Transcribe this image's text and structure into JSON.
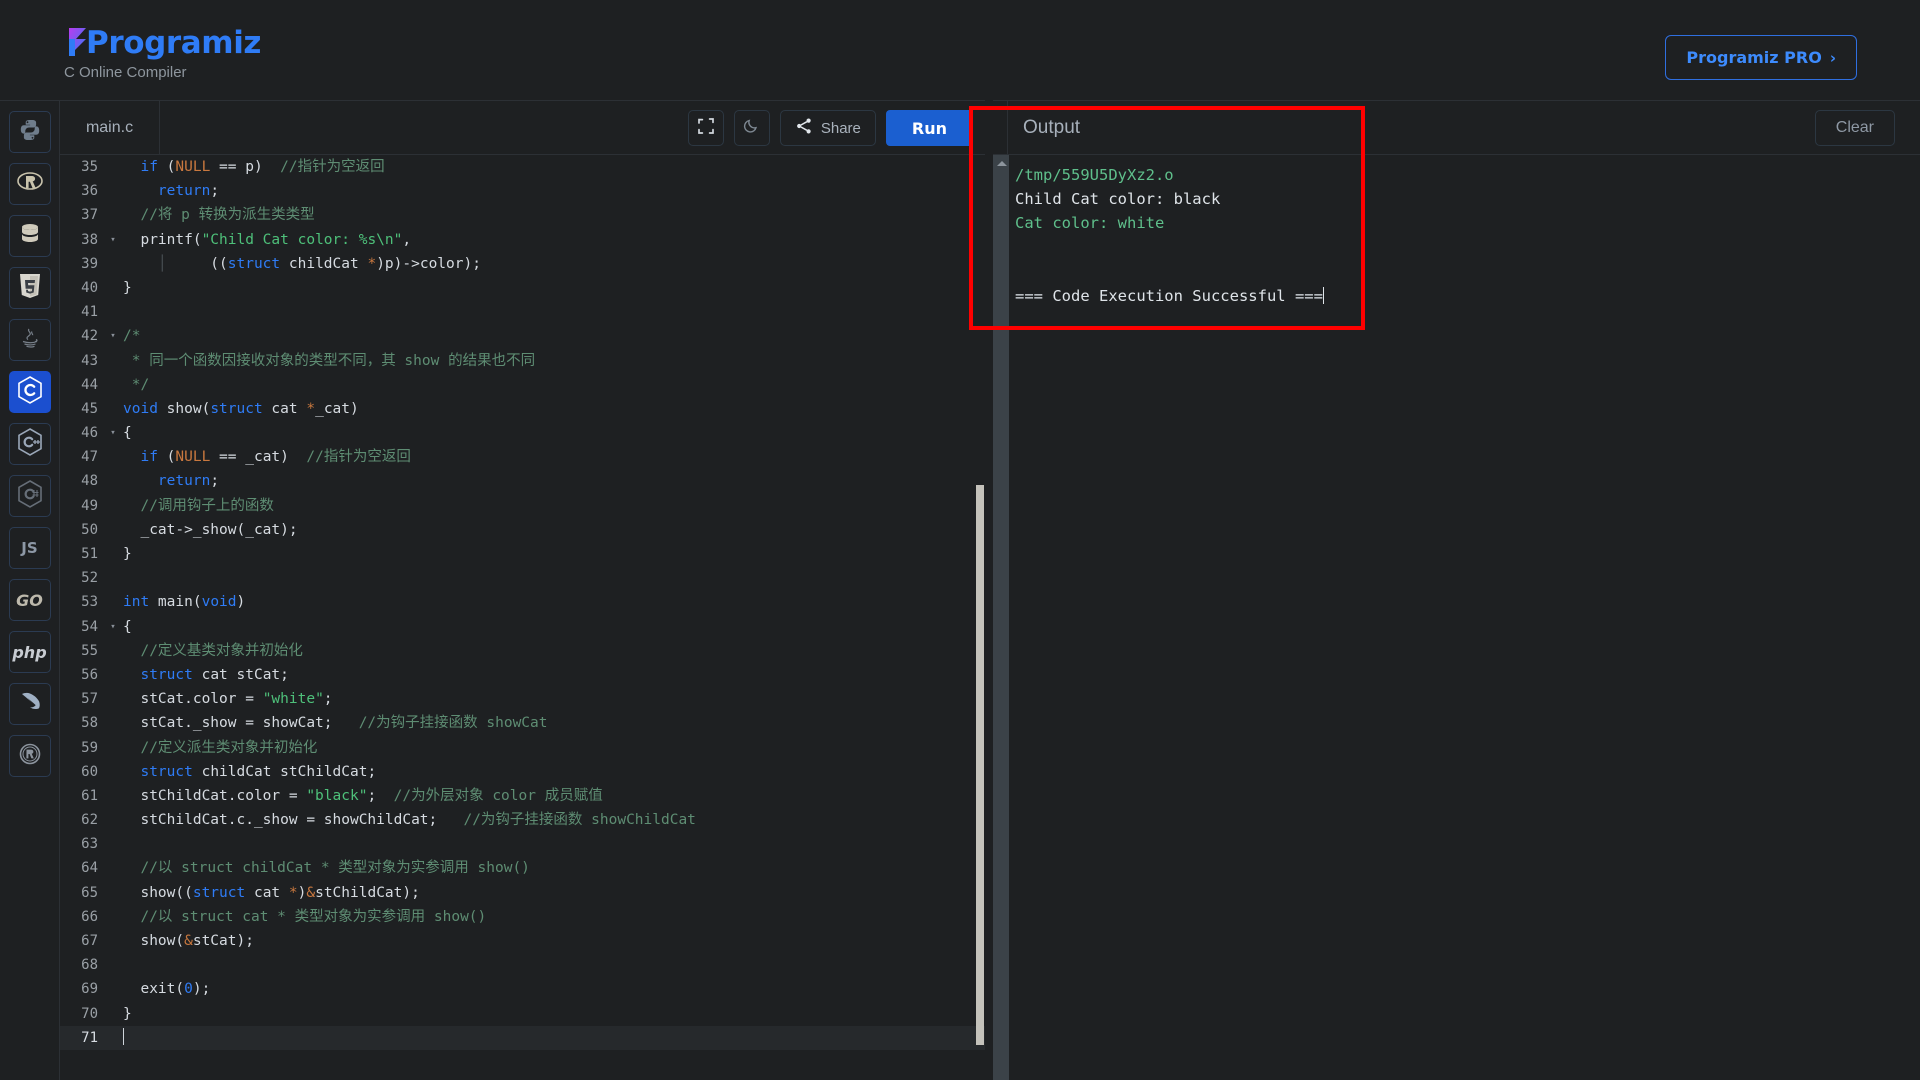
{
  "header": {
    "brand_name": "Programiz",
    "subtitle": "C Online Compiler",
    "pro_button": "Programiz PRO",
    "pro_chevron": "›"
  },
  "sidebar": {
    "items": [
      {
        "name": "python",
        "label": "",
        "icon": "python-icon",
        "active": false
      },
      {
        "name": "r",
        "label": "",
        "icon": "r-icon",
        "active": false
      },
      {
        "name": "sql",
        "label": "",
        "icon": "database-icon",
        "active": false
      },
      {
        "name": "html",
        "label": "",
        "icon": "html5-icon",
        "active": false
      },
      {
        "name": "java",
        "label": "",
        "icon": "java-icon",
        "active": false
      },
      {
        "name": "c",
        "label": "",
        "icon": "c-icon",
        "active": true
      },
      {
        "name": "cpp",
        "label": "",
        "icon": "cpp-icon",
        "active": false
      },
      {
        "name": "csharp",
        "label": "",
        "icon": "csharp-icon",
        "active": false
      },
      {
        "name": "javascript",
        "label": "JS",
        "icon": "js-icon",
        "active": false
      },
      {
        "name": "go",
        "label": "GO",
        "icon": "go-icon",
        "active": false
      },
      {
        "name": "php",
        "label": "php",
        "icon": "php-icon",
        "active": false
      },
      {
        "name": "swift",
        "label": "",
        "icon": "swift-icon",
        "active": false
      },
      {
        "name": "rust",
        "label": "",
        "icon": "rust-icon",
        "active": false
      }
    ]
  },
  "editor": {
    "tab_label": "main.c",
    "fullscreen_icon": "fullscreen-icon",
    "theme_icon": "moon-icon",
    "share_label": "Share",
    "run_label": "Run",
    "active_line": 71,
    "lines": [
      {
        "n": 35,
        "fold": "",
        "tokens": [
          [
            "p",
            "  "
          ],
          [
            "k",
            "if"
          ],
          [
            "p",
            " ("
          ],
          [
            "k2",
            "NULL"
          ],
          [
            "p",
            " == p)  "
          ],
          [
            "c",
            "//指针为空返回"
          ]
        ]
      },
      {
        "n": 36,
        "fold": "",
        "tokens": [
          [
            "p",
            "    "
          ],
          [
            "k",
            "return"
          ],
          [
            "p",
            ";"
          ]
        ]
      },
      {
        "n": 37,
        "fold": "",
        "tokens": [
          [
            "p",
            "  "
          ],
          [
            "c",
            "//将 p 转换为派生类类型"
          ]
        ]
      },
      {
        "n": 38,
        "fold": "▾",
        "tokens": [
          [
            "p",
            "  printf("
          ],
          [
            "s",
            "\"Child Cat color: %s\\n\""
          ],
          [
            "p",
            ","
          ]
        ]
      },
      {
        "n": 39,
        "fold": "",
        "tokens": [
          [
            "p",
            "    "
          ],
          [
            "g",
            "│"
          ],
          [
            "p",
            "     (("
          ],
          [
            "k",
            "struct"
          ],
          [
            "p",
            " childCat "
          ],
          [
            "k2",
            "*"
          ],
          [
            "p",
            ")p)->color);"
          ]
        ]
      },
      {
        "n": 40,
        "fold": "",
        "tokens": [
          [
            "p",
            "}"
          ]
        ]
      },
      {
        "n": 41,
        "fold": "",
        "tokens": []
      },
      {
        "n": 42,
        "fold": "▾",
        "tokens": [
          [
            "c",
            "/*"
          ]
        ]
      },
      {
        "n": 43,
        "fold": "",
        "tokens": [
          [
            "c",
            " * 同一个函数因接收对象的类型不同，其 show 的结果也不同"
          ]
        ]
      },
      {
        "n": 44,
        "fold": "",
        "tokens": [
          [
            "c",
            " */"
          ]
        ]
      },
      {
        "n": 45,
        "fold": "",
        "tokens": [
          [
            "k",
            "void"
          ],
          [
            "p",
            " show("
          ],
          [
            "k",
            "struct"
          ],
          [
            "p",
            " cat "
          ],
          [
            "k2",
            "*"
          ],
          [
            "p",
            "_cat)"
          ]
        ]
      },
      {
        "n": 46,
        "fold": "▾",
        "tokens": [
          [
            "p",
            "{"
          ]
        ]
      },
      {
        "n": 47,
        "fold": "",
        "tokens": [
          [
            "p",
            "  "
          ],
          [
            "k",
            "if"
          ],
          [
            "p",
            " ("
          ],
          [
            "k2",
            "NULL"
          ],
          [
            "p",
            " == _cat)  "
          ],
          [
            "c",
            "//指针为空返回"
          ]
        ]
      },
      {
        "n": 48,
        "fold": "",
        "tokens": [
          [
            "p",
            "    "
          ],
          [
            "k",
            "return"
          ],
          [
            "p",
            ";"
          ]
        ]
      },
      {
        "n": 49,
        "fold": "",
        "tokens": [
          [
            "p",
            "  "
          ],
          [
            "c",
            "//调用钩子上的函数"
          ]
        ]
      },
      {
        "n": 50,
        "fold": "",
        "tokens": [
          [
            "p",
            "  _cat->_show(_cat);"
          ]
        ]
      },
      {
        "n": 51,
        "fold": "",
        "tokens": [
          [
            "p",
            "}"
          ]
        ]
      },
      {
        "n": 52,
        "fold": "",
        "tokens": []
      },
      {
        "n": 53,
        "fold": "",
        "tokens": [
          [
            "k",
            "int"
          ],
          [
            "p",
            " main("
          ],
          [
            "k",
            "void"
          ],
          [
            "p",
            ")"
          ]
        ]
      },
      {
        "n": 54,
        "fold": "▾",
        "tokens": [
          [
            "p",
            "{"
          ]
        ]
      },
      {
        "n": 55,
        "fold": "",
        "tokens": [
          [
            "p",
            "  "
          ],
          [
            "c",
            "//定义基类对象并初始化"
          ]
        ]
      },
      {
        "n": 56,
        "fold": "",
        "tokens": [
          [
            "p",
            "  "
          ],
          [
            "k",
            "struct"
          ],
          [
            "p",
            " cat stCat;"
          ]
        ]
      },
      {
        "n": 57,
        "fold": "",
        "tokens": [
          [
            "p",
            "  stCat.color = "
          ],
          [
            "s",
            "\"white\""
          ],
          [
            "p",
            ";"
          ]
        ]
      },
      {
        "n": 58,
        "fold": "",
        "tokens": [
          [
            "p",
            "  stCat._show = showCat;   "
          ],
          [
            "c",
            "//为钩子挂接函数 showCat"
          ]
        ]
      },
      {
        "n": 59,
        "fold": "",
        "tokens": [
          [
            "p",
            "  "
          ],
          [
            "c",
            "//定义派生类对象并初始化"
          ]
        ]
      },
      {
        "n": 60,
        "fold": "",
        "tokens": [
          [
            "p",
            "  "
          ],
          [
            "k",
            "struct"
          ],
          [
            "p",
            " childCat stChildCat;"
          ]
        ]
      },
      {
        "n": 61,
        "fold": "",
        "tokens": [
          [
            "p",
            "  stChildCat.color = "
          ],
          [
            "s",
            "\"black\""
          ],
          [
            "p",
            "; "
          ],
          [
            "c",
            " //为外层对象 color 成员赋值"
          ]
        ]
      },
      {
        "n": 62,
        "fold": "",
        "tokens": [
          [
            "p",
            "  stChildCat.c._show = showChildCat;   "
          ],
          [
            "c",
            "//为钩子挂接函数 showChildCat"
          ]
        ]
      },
      {
        "n": 63,
        "fold": "",
        "tokens": []
      },
      {
        "n": 64,
        "fold": "",
        "tokens": [
          [
            "p",
            "  "
          ],
          [
            "c",
            "//以 struct childCat * 类型对象为实参调用 show()"
          ]
        ]
      },
      {
        "n": 65,
        "fold": "",
        "tokens": [
          [
            "p",
            "  show(("
          ],
          [
            "k",
            "struct"
          ],
          [
            "p",
            " cat "
          ],
          [
            "k2",
            "*"
          ],
          [
            "p",
            ")"
          ],
          [
            "k2",
            "&"
          ],
          [
            "p",
            "stChildCat);"
          ]
        ]
      },
      {
        "n": 66,
        "fold": "",
        "tokens": [
          [
            "p",
            "  "
          ],
          [
            "c",
            "//以 struct cat * 类型对象为实参调用 show()"
          ]
        ]
      },
      {
        "n": 67,
        "fold": "",
        "tokens": [
          [
            "p",
            "  show("
          ],
          [
            "k2",
            "&"
          ],
          [
            "p",
            "stCat);"
          ]
        ]
      },
      {
        "n": 68,
        "fold": "",
        "tokens": []
      },
      {
        "n": 69,
        "fold": "",
        "tokens": [
          [
            "p",
            "  exit("
          ],
          [
            "n",
            "0"
          ],
          [
            "p",
            ");"
          ]
        ]
      },
      {
        "n": 70,
        "fold": "",
        "tokens": [
          [
            "p",
            "}"
          ]
        ]
      },
      {
        "n": 71,
        "fold": "",
        "tokens": []
      }
    ]
  },
  "output": {
    "title": "Output",
    "clear_label": "Clear",
    "lines": [
      {
        "text": "/tmp/559U5DyXz2.o",
        "color": "green"
      },
      {
        "text": "Child Cat color: black",
        "color": "white"
      },
      {
        "text": "Cat color: white",
        "color": "green"
      },
      {
        "text": "",
        "color": "white"
      },
      {
        "text": "",
        "color": "white"
      },
      {
        "text": "=== Code Execution Successful ===",
        "color": "white",
        "cursor": true
      }
    ]
  },
  "colors": {
    "background": "#1e2022",
    "accent_blue": "#1b5fd0",
    "brand_blue": "#2f7cf6",
    "annotation_red": "#ff0000",
    "output_green": "#5fbf8b"
  }
}
